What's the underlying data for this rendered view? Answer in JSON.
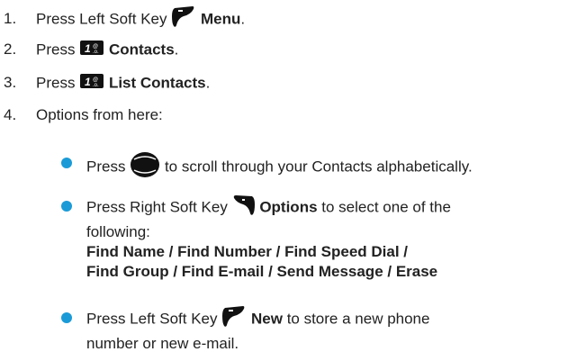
{
  "steps": [
    {
      "num": "1.",
      "pre": "Press Left Soft Key",
      "icon": "left-soft-key-icon",
      "label": "Menu",
      "post": "."
    },
    {
      "num": "2.",
      "pre": "Press",
      "icon": "key-1-icon",
      "label": "Contacts",
      "post": "."
    },
    {
      "num": "3.",
      "pre": "Press",
      "icon": "key-1-icon",
      "label": "List Contacts",
      "post": "."
    },
    {
      "num": "4.",
      "text": "Options from here:"
    }
  ],
  "key_1_glyph": "1",
  "key_1_sub": "@\n.o.",
  "bullets": [
    {
      "pre": "Press",
      "icon": "nav-key-icon",
      "post": "to scroll through your Contacts alphabetically."
    },
    {
      "pre": "Press Right Soft Key",
      "icon": "right-soft-key-icon",
      "label": "Options",
      "post": "to select one of the",
      "line2": "following:",
      "line3": "Find Name / Find Number / Find Speed Dial /",
      "line4": "Find Group / Find E-mail / Send Message / Erase"
    },
    {
      "pre": "Press Left Soft Key",
      "icon": "left-soft-key-icon",
      "label": "New",
      "post": "to store a new phone",
      "line2": "number or new e-mail."
    }
  ],
  "colors": {
    "bullet": "#1a9bd7",
    "text": "#222222",
    "icon": "#111111"
  }
}
